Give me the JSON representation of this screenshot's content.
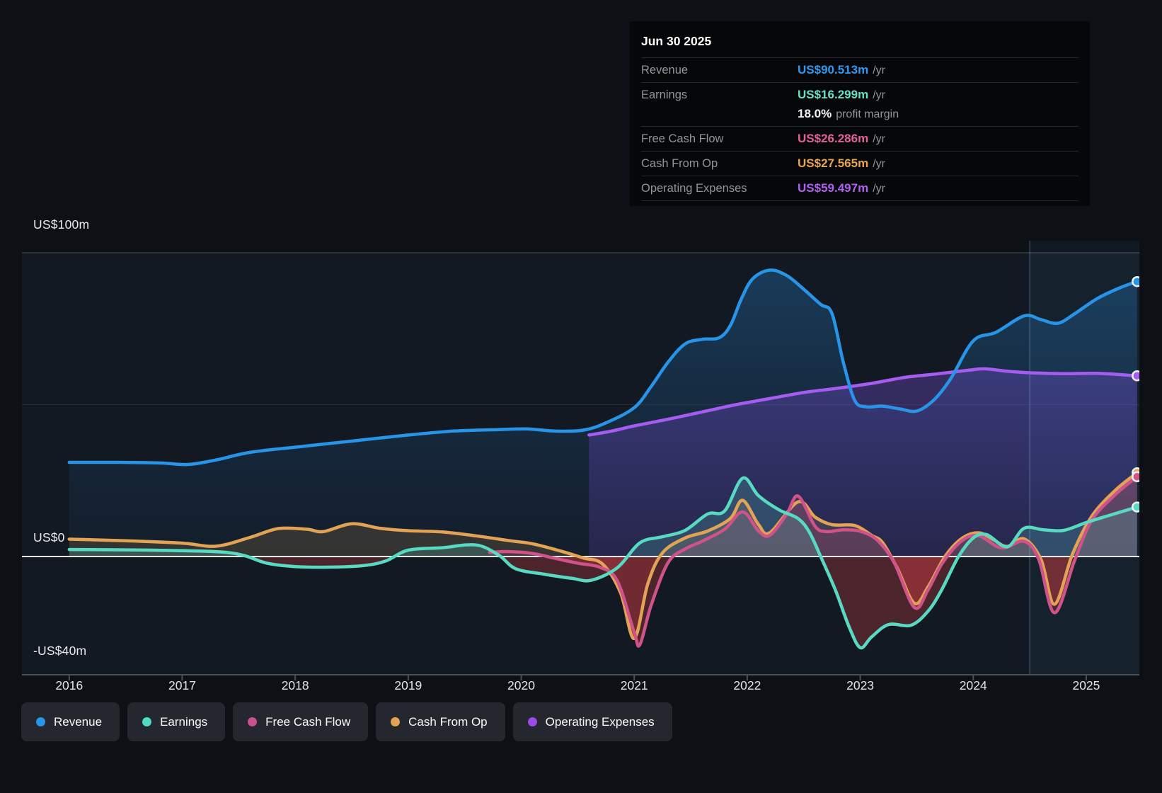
{
  "tooltip": {
    "date": "Jun 30 2025",
    "rows": [
      {
        "label": "Revenue",
        "value": "US$90.513m",
        "unit": "/yr",
        "color": "#2e9bf2"
      },
      {
        "label": "Earnings",
        "value": "US$16.299m",
        "unit": "/yr",
        "color": "#66e2c8",
        "extra": {
          "value": "18.0%",
          "label": "profit margin"
        }
      },
      {
        "label": "Free Cash Flow",
        "value": "US$26.286m",
        "unit": "/yr",
        "color": "#e4609a"
      },
      {
        "label": "Cash From Op",
        "value": "US$27.565m",
        "unit": "/yr",
        "color": "#eaa64f"
      },
      {
        "label": "Operating Expenses",
        "value": "US$59.497m",
        "unit": "/yr",
        "color": "#b160f2"
      }
    ]
  },
  "y_axis": {
    "top": "US$100m",
    "zero": "US$0",
    "bottom": "-US$40m"
  },
  "legend": [
    {
      "label": "Revenue",
      "color": "#2795e9"
    },
    {
      "label": "Earnings",
      "color": "#4fdcc2"
    },
    {
      "label": "Free Cash Flow",
      "color": "#c9518f"
    },
    {
      "label": "Cash From Op",
      "color": "#e3a455"
    },
    {
      "label": "Operating Expenses",
      "color": "#9d4be8"
    }
  ],
  "chart_data": {
    "type": "area",
    "title": "Past earnings and revenue history with Jun 30 2025 values",
    "xlim": [
      2015.97,
      2025.47
    ],
    "ylim": [
      -40,
      100
    ],
    "x_ticks": [
      2016,
      2017,
      2018,
      2019,
      2020,
      2021,
      2022,
      2023,
      2024,
      2025
    ],
    "y_gridline_values": [
      100,
      50,
      0,
      -40
    ],
    "divider_x": 2024.5,
    "grid_on": true,
    "legend_position": "bottom",
    "colors": {
      "revenue": "#2794e8",
      "earnings": "#57d9c2",
      "fcf": "#cf5289",
      "cashop": "#e2a355",
      "opex": "#a65cf0",
      "negative_fill": "rgba(171,56,60,0.38)",
      "zero_line": "#e6e8ea",
      "plot_bg": "#131922",
      "page_bg": "#0d1015",
      "future_band": "rgba(66,126,190,0.08)"
    },
    "series": [
      {
        "name": "Revenue",
        "kind": "band",
        "color": "#2794e8",
        "fill_top": "rgba(39,148,232,0.30)",
        "fill_bottom": "rgba(30,90,150,0.08)",
        "points": [
          [
            2016.0,
            31
          ],
          [
            2016.4,
            31
          ],
          [
            2016.8,
            30.8
          ],
          [
            2017.05,
            30.3
          ],
          [
            2017.3,
            31.8
          ],
          [
            2017.6,
            34.3
          ],
          [
            2018.0,
            36
          ],
          [
            2018.5,
            38
          ],
          [
            2019.0,
            40
          ],
          [
            2019.4,
            41.3
          ],
          [
            2019.8,
            41.8
          ],
          [
            2020.05,
            42
          ],
          [
            2020.3,
            41.3
          ],
          [
            2020.55,
            41.6
          ],
          [
            2020.75,
            44
          ],
          [
            2021.0,
            49
          ],
          [
            2021.15,
            56
          ],
          [
            2021.3,
            64
          ],
          [
            2021.45,
            70
          ],
          [
            2021.6,
            71.5
          ],
          [
            2021.75,
            72
          ],
          [
            2021.85,
            76
          ],
          [
            2021.95,
            85
          ],
          [
            2022.05,
            91.5
          ],
          [
            2022.2,
            94.3
          ],
          [
            2022.35,
            92.5
          ],
          [
            2022.5,
            88
          ],
          [
            2022.65,
            83
          ],
          [
            2022.75,
            80
          ],
          [
            2022.85,
            64
          ],
          [
            2022.95,
            51.5
          ],
          [
            2023.05,
            49.3
          ],
          [
            2023.2,
            49.5
          ],
          [
            2023.35,
            48.6
          ],
          [
            2023.5,
            47.9
          ],
          [
            2023.65,
            51.5
          ],
          [
            2023.8,
            58.5
          ],
          [
            2024.0,
            71
          ],
          [
            2024.2,
            73.8
          ],
          [
            2024.45,
            79.2
          ],
          [
            2024.6,
            78
          ],
          [
            2024.75,
            76.8
          ],
          [
            2024.9,
            80
          ],
          [
            2025.1,
            85
          ],
          [
            2025.3,
            88.5
          ],
          [
            2025.45,
            90.513
          ]
        ]
      },
      {
        "name": "Operating Expenses",
        "kind": "band",
        "color": "#a65cf0",
        "fill_top": "rgba(139,92,246,0.42)",
        "fill_bottom": "rgba(91,61,170,0.26)",
        "points": [
          [
            2020.6,
            40
          ],
          [
            2020.8,
            41.3
          ],
          [
            2021.0,
            43
          ],
          [
            2021.3,
            45.2
          ],
          [
            2021.6,
            47.6
          ],
          [
            2021.9,
            50
          ],
          [
            2022.2,
            52
          ],
          [
            2022.5,
            54
          ],
          [
            2022.8,
            55.4
          ],
          [
            2023.1,
            57
          ],
          [
            2023.4,
            59
          ],
          [
            2023.7,
            60.2
          ],
          [
            2023.95,
            61.3
          ],
          [
            2024.1,
            61.8
          ],
          [
            2024.3,
            61
          ],
          [
            2024.5,
            60.5
          ],
          [
            2024.8,
            60.2
          ],
          [
            2025.1,
            60.3
          ],
          [
            2025.45,
            59.497
          ]
        ]
      },
      {
        "name": "Cash From Op",
        "kind": "cash",
        "color": "#e2a355",
        "pos_fill": "rgba(226,163,85,0.16)",
        "points": [
          [
            2016.0,
            5.7
          ],
          [
            2016.5,
            5.2
          ],
          [
            2017.0,
            4.4
          ],
          [
            2017.3,
            3.4
          ],
          [
            2017.6,
            6.3
          ],
          [
            2017.85,
            9.2
          ],
          [
            2018.1,
            9.0
          ],
          [
            2018.25,
            8.2
          ],
          [
            2018.5,
            10.8
          ],
          [
            2018.75,
            9.3
          ],
          [
            2019.0,
            8.5
          ],
          [
            2019.3,
            8.1
          ],
          [
            2019.6,
            6.8
          ],
          [
            2019.9,
            5.2
          ],
          [
            2020.1,
            4.2
          ],
          [
            2020.35,
            1.8
          ],
          [
            2020.55,
            -0.5
          ],
          [
            2020.72,
            -2.5
          ],
          [
            2020.88,
            -12
          ],
          [
            2021.0,
            -27
          ],
          [
            2021.12,
            -9
          ],
          [
            2021.25,
            1.2
          ],
          [
            2021.45,
            6.1
          ],
          [
            2021.65,
            8.4
          ],
          [
            2021.85,
            12.5
          ],
          [
            2021.96,
            18.5
          ],
          [
            2022.1,
            10.5
          ],
          [
            2022.2,
            7.8
          ],
          [
            2022.45,
            18
          ],
          [
            2022.6,
            13
          ],
          [
            2022.75,
            10.5
          ],
          [
            2022.95,
            10.2
          ],
          [
            2023.1,
            7
          ],
          [
            2023.2,
            4.5
          ],
          [
            2023.33,
            -4
          ],
          [
            2023.48,
            -15.4
          ],
          [
            2023.6,
            -10
          ],
          [
            2023.75,
            0
          ],
          [
            2023.9,
            6
          ],
          [
            2024.05,
            7.8
          ],
          [
            2024.18,
            5.5
          ],
          [
            2024.3,
            3.3
          ],
          [
            2024.45,
            5.8
          ],
          [
            2024.6,
            -1
          ],
          [
            2024.72,
            -15.7
          ],
          [
            2024.88,
            1
          ],
          [
            2025.05,
            13.3
          ],
          [
            2025.26,
            21.9
          ],
          [
            2025.45,
            27.565
          ]
        ]
      },
      {
        "name": "Free Cash Flow",
        "kind": "cash",
        "color": "#cf5289",
        "pos_fill": "rgba(207,82,137,0.16)",
        "points": [
          [
            2019.72,
            1.4
          ],
          [
            2019.9,
            1.6
          ],
          [
            2020.1,
            1
          ],
          [
            2020.3,
            -0.6
          ],
          [
            2020.5,
            -2.2
          ],
          [
            2020.7,
            -3.6
          ],
          [
            2020.85,
            -8
          ],
          [
            2021.0,
            -25
          ],
          [
            2021.05,
            -29
          ],
          [
            2021.15,
            -16
          ],
          [
            2021.3,
            -2
          ],
          [
            2021.45,
            2.5
          ],
          [
            2021.6,
            5
          ],
          [
            2021.8,
            9
          ],
          [
            2021.96,
            14.7
          ],
          [
            2022.1,
            8.4
          ],
          [
            2022.2,
            7
          ],
          [
            2022.35,
            14
          ],
          [
            2022.45,
            19.9
          ],
          [
            2022.6,
            10
          ],
          [
            2022.7,
            8.2
          ],
          [
            2022.85,
            8.8
          ],
          [
            2023.0,
            8.3
          ],
          [
            2023.15,
            5.4
          ],
          [
            2023.3,
            -2
          ],
          [
            2023.48,
            -16.8
          ],
          [
            2023.6,
            -11
          ],
          [
            2023.73,
            -2
          ],
          [
            2023.9,
            5.2
          ],
          [
            2024.05,
            6.8
          ],
          [
            2024.25,
            2.8
          ],
          [
            2024.45,
            5.0
          ],
          [
            2024.58,
            -1
          ],
          [
            2024.72,
            -18.5
          ],
          [
            2024.9,
            -1
          ],
          [
            2025.05,
            12
          ],
          [
            2025.26,
            20.5
          ],
          [
            2025.45,
            26.286
          ]
        ]
      },
      {
        "name": "Earnings",
        "kind": "cash",
        "color": "#57d9c2",
        "pos_fill": "rgba(87,217,194,0.20)",
        "points": [
          [
            2016.0,
            2.3
          ],
          [
            2016.5,
            2.2
          ],
          [
            2017.0,
            1.9
          ],
          [
            2017.35,
            1.5
          ],
          [
            2017.55,
            0.3
          ],
          [
            2017.75,
            -2.2
          ],
          [
            2018.0,
            -3.3
          ],
          [
            2018.3,
            -3.5
          ],
          [
            2018.6,
            -3.0
          ],
          [
            2018.8,
            -1.5
          ],
          [
            2019.0,
            2.1
          ],
          [
            2019.3,
            2.9
          ],
          [
            2019.6,
            3.8
          ],
          [
            2019.8,
            0.5
          ],
          [
            2019.95,
            -4
          ],
          [
            2020.2,
            -5.8
          ],
          [
            2020.45,
            -7.2
          ],
          [
            2020.62,
            -7.8
          ],
          [
            2020.85,
            -3.7
          ],
          [
            2021.05,
            4.5
          ],
          [
            2021.25,
            6.5
          ],
          [
            2021.45,
            8.6
          ],
          [
            2021.65,
            14
          ],
          [
            2021.8,
            15
          ],
          [
            2021.96,
            25.8
          ],
          [
            2022.1,
            20
          ],
          [
            2022.28,
            15.4
          ],
          [
            2022.45,
            12.5
          ],
          [
            2022.55,
            8
          ],
          [
            2022.65,
            0
          ],
          [
            2022.78,
            -11
          ],
          [
            2022.9,
            -23
          ],
          [
            2023.0,
            -30
          ],
          [
            2023.1,
            -26.5
          ],
          [
            2023.25,
            -22.4
          ],
          [
            2023.45,
            -22.6
          ],
          [
            2023.6,
            -18
          ],
          [
            2023.72,
            -11
          ],
          [
            2023.87,
            0
          ],
          [
            2024.0,
            6.1
          ],
          [
            2024.12,
            7.2
          ],
          [
            2024.3,
            3.2
          ],
          [
            2024.45,
            9.3
          ],
          [
            2024.62,
            8.8
          ],
          [
            2024.8,
            8.6
          ],
          [
            2025.0,
            11.2
          ],
          [
            2025.2,
            13.5
          ],
          [
            2025.45,
            16.299
          ]
        ]
      }
    ]
  }
}
